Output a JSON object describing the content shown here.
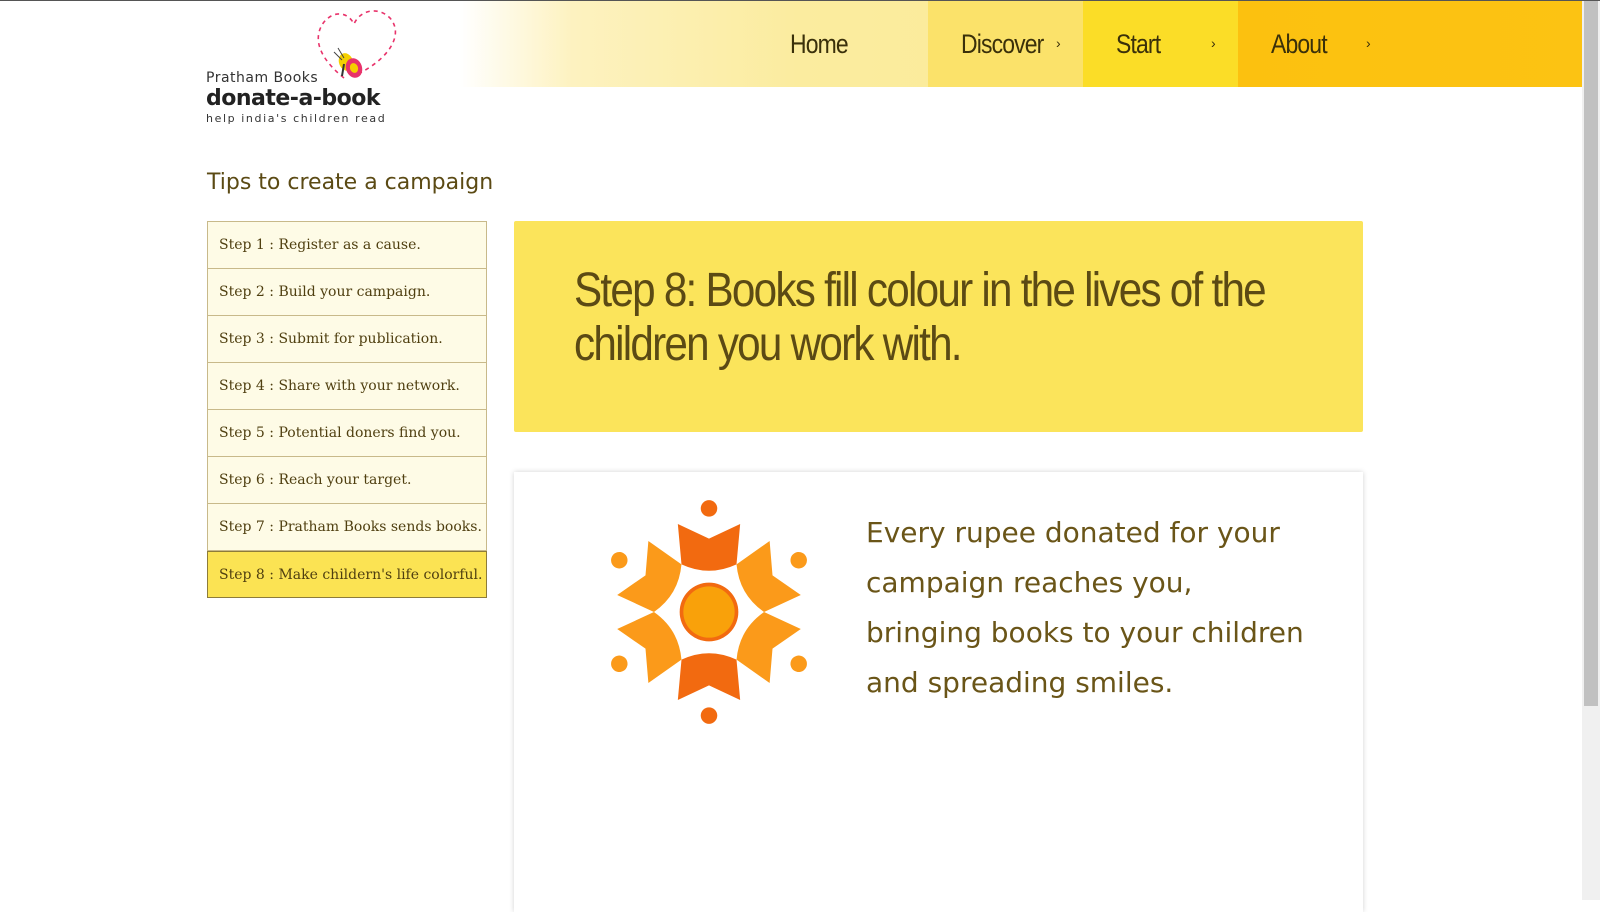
{
  "logo": {
    "brand": "Pratham Books",
    "name": "donate-a-book",
    "tagline": "help india's children read",
    "icon": "heart-butterfly-icon"
  },
  "nav": {
    "items": [
      {
        "label": "Home",
        "has_arrow": false
      },
      {
        "label": "Discover",
        "has_arrow": true
      },
      {
        "label": "Start",
        "has_arrow": true
      },
      {
        "label": "About",
        "has_arrow": true
      }
    ],
    "arrow_glyph": "›"
  },
  "sidebar": {
    "title": "Tips to create a campaign",
    "steps": [
      {
        "label": "Step 1 : Register as a cause."
      },
      {
        "label": "Step 2 : Build your campaign."
      },
      {
        "label": "Step 3 : Submit for publication."
      },
      {
        "label": "Step 4 : Share with your network."
      },
      {
        "label": "Step 5 : Potential doners find you."
      },
      {
        "label": "Step 6 : Reach your target."
      },
      {
        "label": "Step 7 : Pratham Books sends books."
      },
      {
        "label": "Step 8 : Make childern's life colorful."
      }
    ],
    "active_index": 7
  },
  "hero": {
    "title": "Step 8: Books fill colour in the lives of the children you work with."
  },
  "card": {
    "text": "Every rupee donated for your campaign reaches you, bringing books to your children and spreading smiles.",
    "icon": "flower-icon"
  },
  "colors": {
    "accent_yellow": "#fbe45b",
    "active_step": "#fbe353",
    "nav_start": "#fbdd27",
    "nav_about": "#fcc10f",
    "flower_dark": "#f26a10",
    "flower_light": "#fb9a1a",
    "flower_center": "#f9a10a",
    "text_brown": "#5b4a14"
  }
}
